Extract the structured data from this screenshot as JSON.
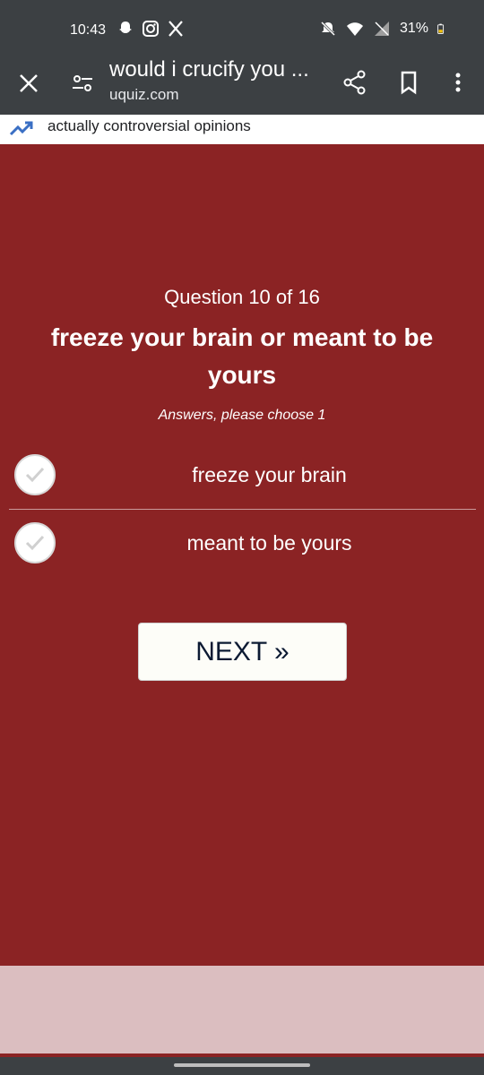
{
  "status_bar": {
    "time": "10:43",
    "battery": "31%",
    "icons_left": [
      "snapchat-icon",
      "instagram-icon",
      "x-icon"
    ],
    "icons_right": [
      "bell-muted-icon",
      "wifi-icon",
      "no-signal-icon",
      "battery-icon"
    ]
  },
  "browser": {
    "title": "would i crucify you ...",
    "url": "uquiz.com"
  },
  "trending": {
    "text": "actually controversial opinions"
  },
  "quiz": {
    "counter": "Question 10 of 16",
    "title": "freeze your brain or meant to be yours",
    "instruction": "Answers, please choose 1",
    "answers": [
      {
        "label": "freeze your brain",
        "selected": false
      },
      {
        "label": "meant to be yours",
        "selected": false
      }
    ],
    "next_label": "NEXT »"
  },
  "colors": {
    "quiz_background": "#8b2324",
    "chrome": "#3c4043",
    "bottom_band": "#dbbec0",
    "button_bg": "#fdfdf8",
    "button_text": "#0c1a33"
  }
}
